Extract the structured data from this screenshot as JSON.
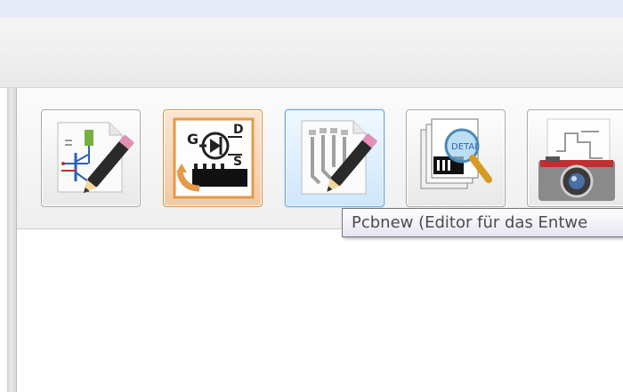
{
  "toolbar": {
    "tools": [
      {
        "name": "eeschema",
        "icon": "schematic-editor-icon"
      },
      {
        "name": "symbol-converter",
        "icon": "component-convert-icon"
      },
      {
        "name": "pcbnew",
        "icon": "pcb-editor-icon",
        "active": true
      },
      {
        "name": "gerbview",
        "icon": "gerber-viewer-icon"
      },
      {
        "name": "bitmap2component",
        "icon": "image-to-component-icon"
      }
    ]
  },
  "tooltip": {
    "text": "Pcbnew (Editor für das Entwe"
  },
  "colors": {
    "active_tool_border": "#6fa9dd",
    "active_tool_bg": "#cfe6fb",
    "tooltip_border": "#767676",
    "tooltip_text": "#4c4c4c"
  }
}
